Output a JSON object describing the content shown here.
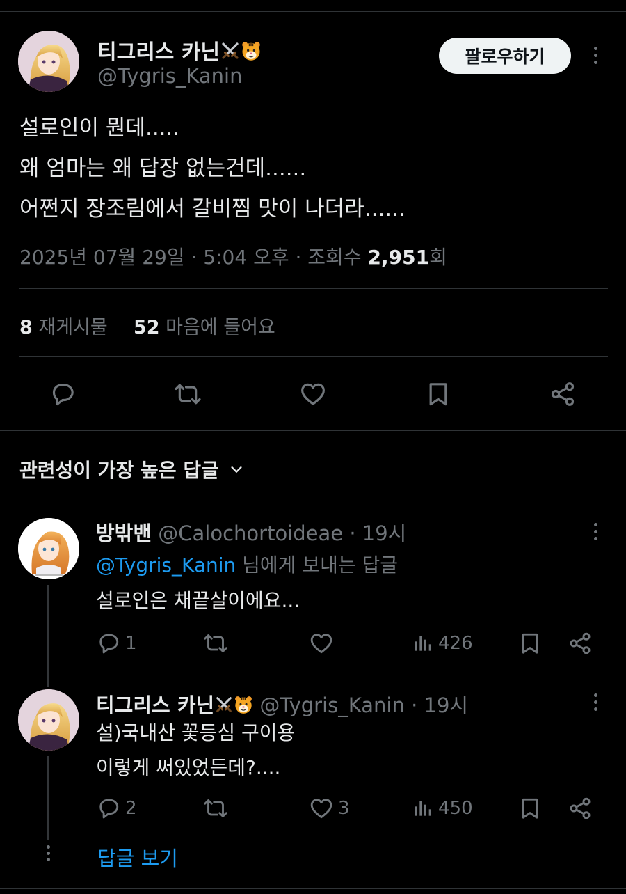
{
  "tweet": {
    "display_name": "티그리스 카닌",
    "handle": "@Tygris_Kanin",
    "follow_label": "팔로우하기",
    "lines": [
      "설로인이 뭔데.....",
      "왜 엄마는 왜 답장 없는건데......",
      "어쩐지 장조림에서 갈비찜 맛이 나더라......"
    ],
    "date": "2025년 07월 29일 · 5:04 오후 · 조회수 ",
    "views": "2,951",
    "views_unit": "회",
    "reposts_count": "8",
    "reposts_label": "재게시물",
    "likes_count": "52",
    "likes_label": "마음에 들어요"
  },
  "sort": {
    "label": "관련성이 가장 높은 답글"
  },
  "replies": [
    {
      "display_name": "방밖밴",
      "handle": "@Calochortoideae",
      "time": " · 19시",
      "reply_to_handle": "@Tygris_Kanin",
      "reply_to_suffix": " 님에게 보내는 답글",
      "lines": [
        "설로인은 채끝살이에요..."
      ],
      "comments": "1",
      "reposts": "",
      "likes": "",
      "views": "426"
    },
    {
      "display_name": "티그리스 카닌",
      "handle": "@Tygris_Kanin",
      "time": " · 19시",
      "lines": [
        "설)국내산 꽃등심 구이용",
        "이렇게 써있었든데?...."
      ],
      "comments": "2",
      "reposts": "",
      "likes": "3",
      "views": "450"
    }
  ],
  "show_replies": {
    "label": "답글 보기"
  },
  "colors": {
    "accent": "#1d9bf0",
    "background": "#000000",
    "text": "#e7e9ea",
    "muted": "#71767b",
    "divider": "#2f3336"
  },
  "icons": [
    "reply-icon",
    "repost-icon",
    "like-icon",
    "bookmark-icon",
    "share-icon",
    "views-icon",
    "more-icon",
    "crossed-swords-emoji",
    "tiger-face-emoji",
    "chevron-down-icon"
  ]
}
